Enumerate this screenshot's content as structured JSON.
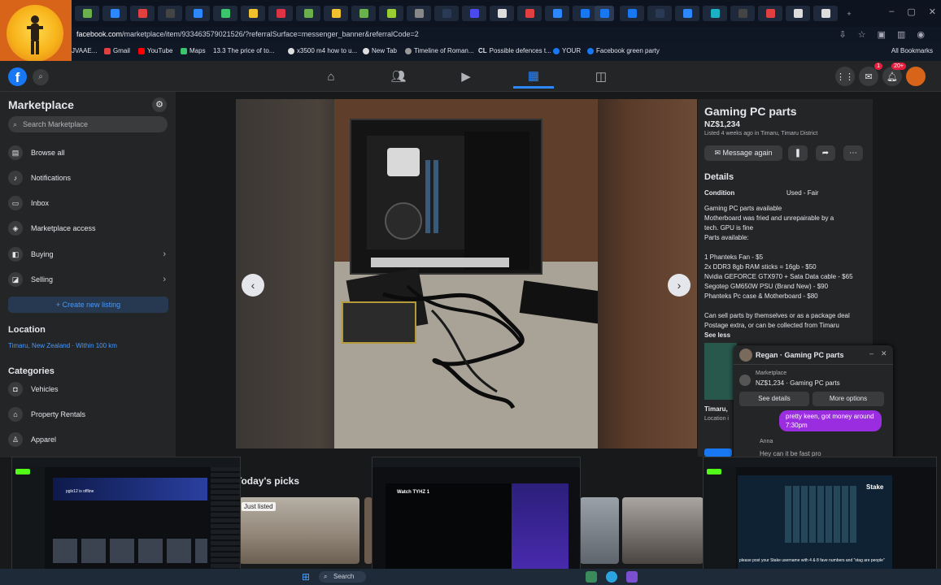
{
  "browser": {
    "url_host": "facebook.com",
    "url_path": "/marketplace/item/933463579021526/?referralSurface=messenger_banner&referralCode=2",
    "bookmarks": [
      "JVAAE...",
      "Gmail",
      "YouTube",
      "Maps",
      "13.3 The price of to...",
      "x3500 m4 how to u...",
      "New Tab",
      "Timeline of Roman...",
      "Possible defences t...",
      "YOUR",
      "Facebook green party"
    ],
    "all_bookmarks": "All Bookmarks"
  },
  "fbnav": {
    "messenger_badge": "1",
    "notif_badge": "20+"
  },
  "sidebar": {
    "title": "Marketplace",
    "search_placeholder": "Search Marketplace",
    "items": [
      {
        "label": "Browse all"
      },
      {
        "label": "Notifications"
      },
      {
        "label": "Inbox"
      },
      {
        "label": "Marketplace access"
      },
      {
        "label": "Buying"
      },
      {
        "label": "Selling"
      }
    ],
    "create_listing": "+ Create new listing",
    "location_heading": "Location",
    "location_value": "Timaru, New Zealand · Within 100 km",
    "categories_heading": "Categories",
    "categories": [
      "Vehicles",
      "Property Rentals",
      "Apparel"
    ]
  },
  "listing": {
    "title": "Gaming PC parts",
    "price": "NZ$1,234",
    "listed": "Listed 4 weeks ago in Timaru, Timaru District",
    "message_again": "Message again",
    "details_heading": "Details",
    "condition_label": "Condition",
    "condition_value": "Used - Fair",
    "description": [
      "Gaming PC parts available",
      "Motherboard was fried and unrepairable by a",
      "tech. GPU is fine",
      "Parts available:",
      "",
      "1 Phanteks Fan - $5",
      "2x DDR3 8gb RAM sticks = 16gb - $50",
      "Nvidia GEFORCE GTX970 + Sata Data cable - $65",
      "Segotep GM650W PSU (Brand New) - $90",
      "Phanteks Pc case & Motherboard - $80",
      "",
      "Can sell parts by themselves or as a package deal",
      "Postage extra, or can be collected from Timaru"
    ],
    "see_less": "See less",
    "seller_name": "Timaru, ",
    "seller_loc": "Location i"
  },
  "chat": {
    "title": "Regan · Gaming PC parts",
    "mp_label": "Marketplace",
    "mp_item": "NZ$1,234 · Gaming PC parts",
    "see_details": "See details",
    "more_options": "More options",
    "bubble": "pretty keen, got money around 7:30pm",
    "sender": "Anna",
    "next": "Hey can it be fast pro"
  },
  "picks": {
    "heading": "Today's picks",
    "just_listed": "Just listed"
  },
  "taskbar": {
    "search": "Search"
  },
  "thumbs": {
    "left_title": "pglx12 is offline",
    "mid_title": "Watch TYHZ 1",
    "right_logo": "Stake",
    "right_caption": "please post your Stake username with 4 & 8 fave numbers and \"stag are people\""
  },
  "colors": {
    "fb_blue": "#1877f2",
    "accent_blue": "#2d88ff",
    "bubble_purple": "#9a2de0",
    "panel": "#242526"
  }
}
